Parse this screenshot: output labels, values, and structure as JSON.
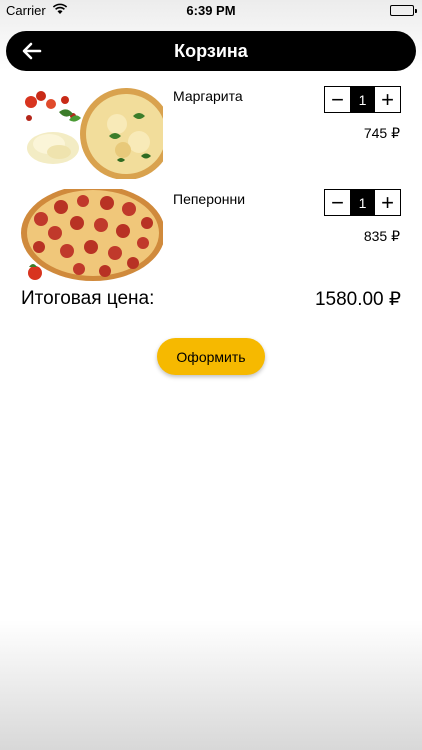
{
  "status_bar": {
    "carrier": "Carrier",
    "time": "6:39 PM"
  },
  "header": {
    "title": "Корзина",
    "back_icon": "arrow-left-icon"
  },
  "cart": {
    "items": [
      {
        "name": "Маргарита",
        "quantity": "1",
        "price": "745 ₽",
        "minus": "−",
        "plus": "+"
      },
      {
        "name": "Пеперонни",
        "quantity": "1",
        "price": "835 ₽",
        "minus": "−",
        "plus": "+"
      }
    ],
    "total_label": "Итоговая цена:",
    "total_value": "1580.00 ₽",
    "checkout_label": "Оформить"
  },
  "colors": {
    "accent": "#f6b900",
    "header_bg": "#000000"
  }
}
